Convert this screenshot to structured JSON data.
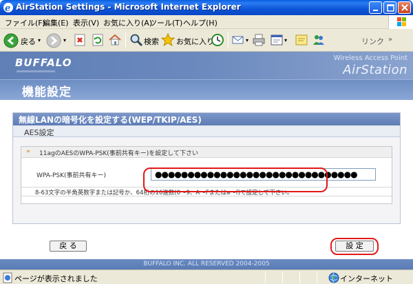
{
  "window": {
    "title": "AirStation Settings - Microsoft Internet Explorer"
  },
  "menu": {
    "items": [
      "ファイル(F)",
      "編集(E)",
      "表示(V)",
      "お気に入り(A)",
      "ツール(T)",
      "ヘルプ(H)"
    ]
  },
  "toolbar": {
    "back_label": "戻る",
    "search_label": "検索",
    "favorites_label": "お気に入り",
    "links_label": "リンク"
  },
  "header": {
    "brand": "BUFFALO",
    "product_tag": "Wireless Access Point",
    "product_name": "AirStation"
  },
  "page": {
    "title": "機能設定",
    "section_title": "無線LANの暗号化を設定する(WEP/TKIP/AES)",
    "subsection_title": "AES設定",
    "instruction": "11agのAESのWPA-PSK(事前共有キー)を設定して下さい",
    "psk_label": "WPA-PSK(事前共有キー)",
    "psk_value": "●●●●●●●●●●●●●●●●●●●●●●●●●●●●●●●",
    "hint": "8-63文字の半角英数字または記号か、64桁の16進数(0～9、A～Fまたはa～f)で設定して下さい。",
    "back_button": "戻 る",
    "set_button": "設 定",
    "footer": "BUFFALO INC. ALL RESERVED 2004-2005"
  },
  "status": {
    "message": "ページが表示されました",
    "zone": "インターネット"
  },
  "colors": {
    "highlight": "#e01818",
    "header_blue": "#6a88bd"
  }
}
